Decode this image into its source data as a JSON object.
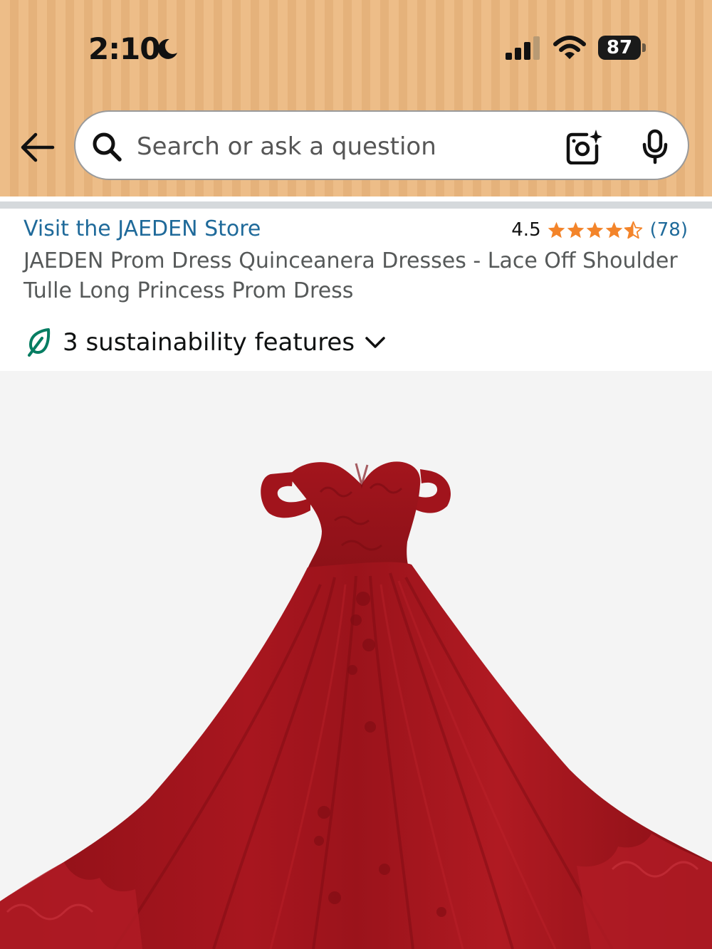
{
  "status_bar": {
    "time": "2:10",
    "battery": "87"
  },
  "search": {
    "placeholder": "Search or ask a question"
  },
  "icons": {
    "back": "arrow-left-icon",
    "search": "search-icon",
    "camera": "camera-sparkle-icon",
    "mic": "microphone-icon",
    "leaf": "leaf-icon",
    "chevron": "chevron-down-icon"
  },
  "product": {
    "store_link": "Visit the JAEDEN Store",
    "rating": "4.5",
    "stars": 4.5,
    "review_count": "(78)",
    "title": "JAEDEN Prom Dress Quinceanera Dresses - Lace Off Shoulder Tulle Long Princess Prom Dress",
    "sustainability": "3 sustainability features"
  },
  "colors": {
    "header_bg": "#ecb87f",
    "link": "#1f6a9a",
    "star": "#f3842a",
    "leaf": "#067d62",
    "dress": "#a3151d"
  }
}
